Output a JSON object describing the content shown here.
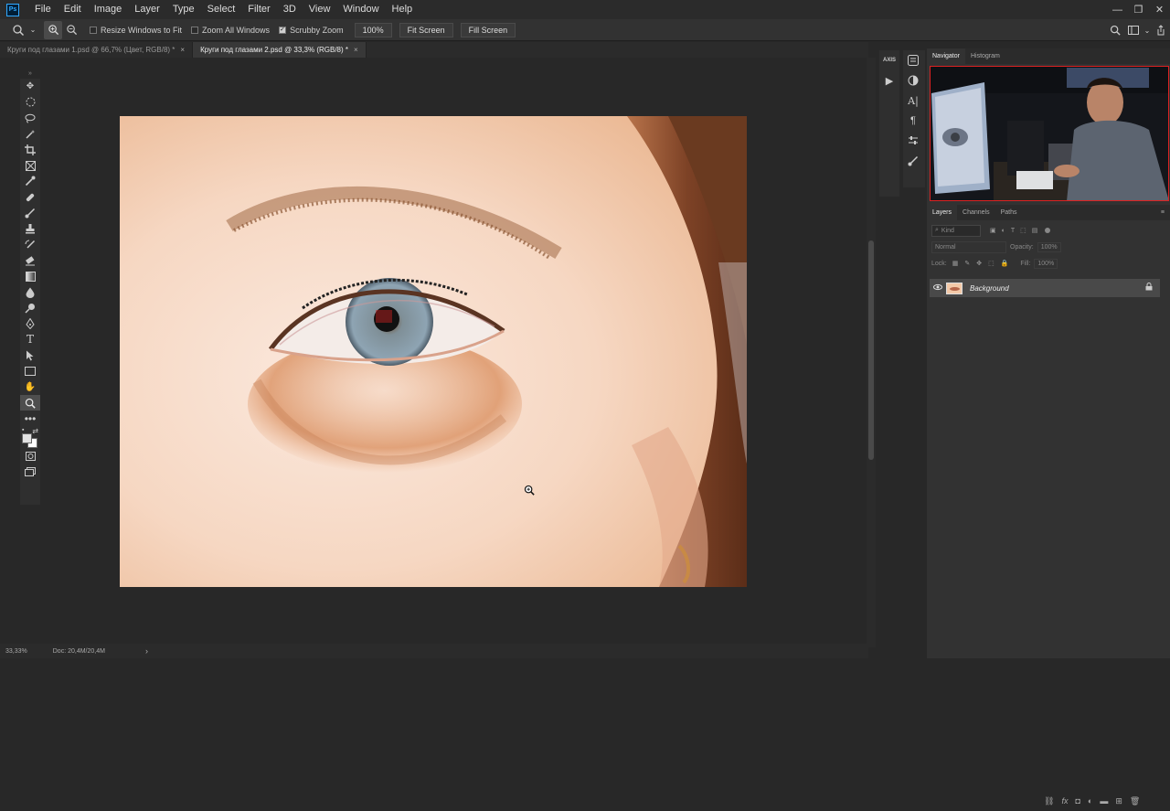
{
  "app": {
    "logo": "Ps"
  },
  "menubar": {
    "items": [
      "File",
      "Edit",
      "Image",
      "Layer",
      "Type",
      "Select",
      "Filter",
      "3D",
      "View",
      "Window",
      "Help"
    ],
    "window_controls": [
      "—",
      "❐",
      "✕"
    ]
  },
  "options": {
    "resize_windows": "Resize Windows to Fit",
    "zoom_all": "Zoom All Windows",
    "scrubby_zoom": "Scrubby Zoom",
    "zoom_value": "100%",
    "fit_screen": "Fit Screen",
    "fill_screen": "Fill Screen",
    "resize_windows_checked": false,
    "zoom_all_checked": false,
    "scrubby_zoom_checked": true
  },
  "tabs": [
    {
      "label": "Круги под глазами 1.psd @ 66,7% (Цвет, RGB/8) *",
      "active": false
    },
    {
      "label": "Круги под глазами 2.psd @ 33,3% (RGB/8) *",
      "active": true
    }
  ],
  "statusbar": {
    "zoom": "33,33%",
    "doc": "Doc: 20,4M/20,4M"
  },
  "panels": {
    "navigator_tabs": [
      "Navigator",
      "Histogram"
    ],
    "layers_tabs": [
      "Layers",
      "Channels",
      "Paths"
    ],
    "kind_label": "Kind",
    "blend_mode": "Normal",
    "opacity_label": "Opacity:",
    "opacity_value": "100%",
    "lock_label": "Lock:",
    "fill_label": "Fill:",
    "fill_value": "100%",
    "layer_name": "Background",
    "strip_logo": "AXIS"
  }
}
